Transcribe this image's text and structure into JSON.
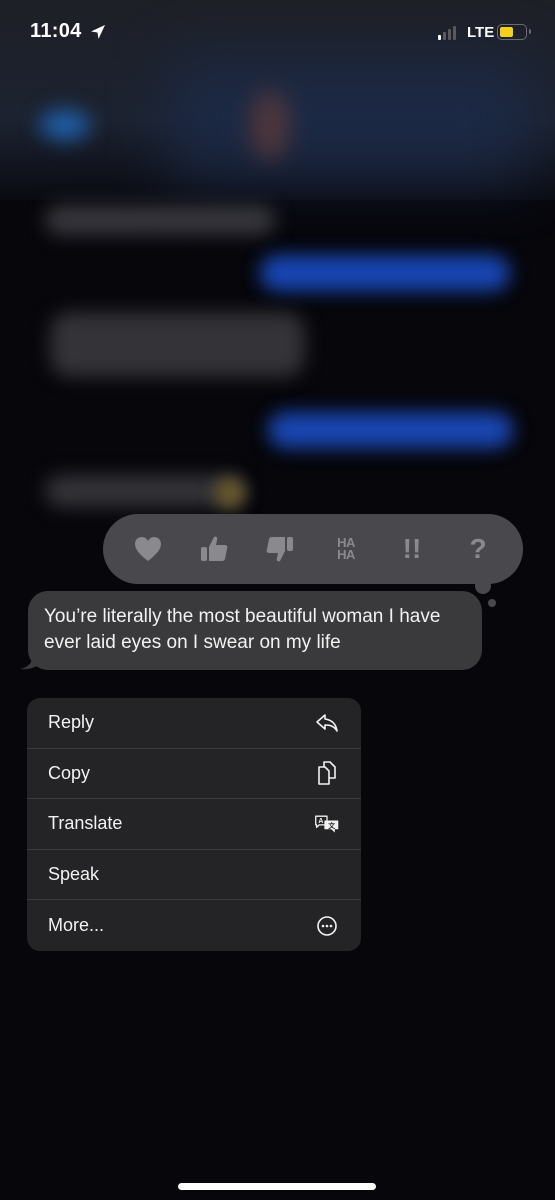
{
  "status_bar": {
    "time": "11:04",
    "location_icon": "location-arrow-icon",
    "signal_bars_active": 1,
    "signal_bars_total": 4,
    "network": "LTE",
    "battery_level": 0.55,
    "battery_color": "#f5cf1b"
  },
  "tapback": {
    "reactions": [
      {
        "name": "heart",
        "icon": "heart-icon"
      },
      {
        "name": "thumbs-up",
        "icon": "thumbs-up-icon"
      },
      {
        "name": "thumbs-down",
        "icon": "thumbs-down-icon"
      },
      {
        "name": "haha",
        "icon": "haha-icon",
        "text_line1": "HA",
        "text_line2": "HA"
      },
      {
        "name": "emphasize",
        "icon": "double-exclamation-icon",
        "text": "!!"
      },
      {
        "name": "question",
        "icon": "question-mark-icon",
        "text": "?"
      }
    ]
  },
  "message": {
    "text": "You’re literally the most beautiful woman I have ever laid eyes on I swear on my life"
  },
  "context_menu": {
    "items": [
      {
        "label": "Reply",
        "icon": "reply-icon"
      },
      {
        "label": "Copy",
        "icon": "copy-icon"
      },
      {
        "label": "Translate",
        "icon": "translate-icon"
      },
      {
        "label": "Speak",
        "icon": ""
      },
      {
        "label": "More...",
        "icon": "more-icon"
      }
    ]
  },
  "colors": {
    "background": "#06060b",
    "bubble": "#3a3a3c",
    "menu": "#242426",
    "tapback_bar": "#49494d",
    "tapback_icon": "#8a8a8e",
    "blurred_sent_bubble": "#1846b3"
  }
}
